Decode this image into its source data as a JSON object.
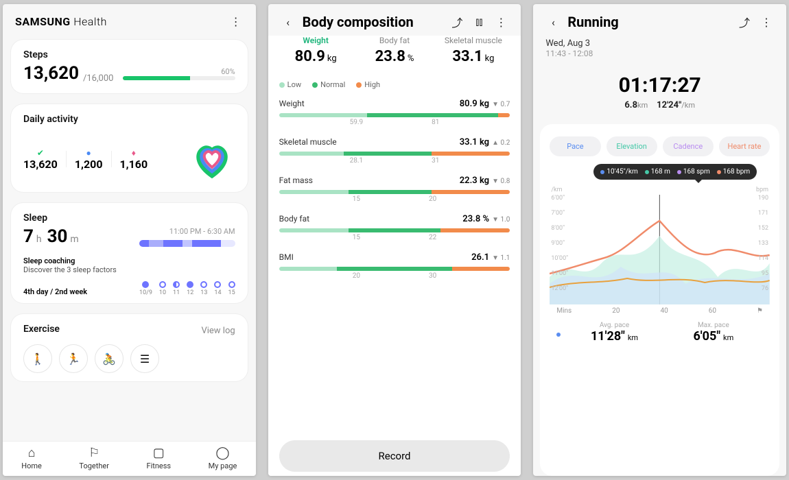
{
  "home": {
    "brand_left": "SAMSUNG",
    "brand_right": "Health",
    "steps": {
      "title": "Steps",
      "count": "13,620",
      "target_prefix": "/",
      "target": "16,000",
      "percent": "60%",
      "bar_pct": 60
    },
    "daily": {
      "title": "Daily activity",
      "val1": "13,620",
      "val2": "1,200",
      "val3": "1,160"
    },
    "sleep": {
      "title": "Sleep",
      "h": "7",
      "h_unit": "h",
      "m": "30",
      "m_unit": "m",
      "range": "11:00 PM - 6:30 AM",
      "coach_title": "Sleep coaching",
      "coach_sub": "Discover the 3 sleep factors",
      "coach_prog": "4th day / 2nd week",
      "days": [
        {
          "lbl": "10/9",
          "state": "f"
        },
        {
          "lbl": "10",
          "state": "o"
        },
        {
          "lbl": "11",
          "state": "half"
        },
        {
          "lbl": "12",
          "state": "f"
        },
        {
          "lbl": "13",
          "state": "o"
        },
        {
          "lbl": "14",
          "state": "o"
        },
        {
          "lbl": "15",
          "state": "o"
        }
      ]
    },
    "exercise": {
      "title": "Exercise",
      "view_log": "View log"
    },
    "nav": {
      "home": "Home",
      "together": "Together",
      "fitness": "Fitness",
      "mypage": "My page"
    }
  },
  "body": {
    "title": "Body composition",
    "summary": {
      "weight_lbl": "Weight",
      "weight_val": "80.9",
      "weight_unit": "kg",
      "fat_lbl": "Body fat",
      "fat_val": "23.8",
      "fat_unit": "%",
      "muscle_lbl": "Skeletal muscle",
      "muscle_val": "33.1",
      "muscle_unit": "kg"
    },
    "legend": {
      "low": "Low",
      "normal": "Normal",
      "high": "High"
    },
    "metrics": [
      {
        "name": "Weight",
        "val": "80.9 kg",
        "delta": "▼ 0.7",
        "t1": "59.9",
        "t2": "81",
        "low": 38,
        "norm": 57,
        "high": 5
      },
      {
        "name": "Skeletal muscle",
        "val": "33.1 kg",
        "delta": "▲ 0.2",
        "t1": "28.1",
        "t2": "31",
        "low": 28,
        "norm": 38,
        "high": 34
      },
      {
        "name": "Fat mass",
        "val": "22.3 kg",
        "delta": "▼ 0.8",
        "t1": "15",
        "t2": "20",
        "low": 30,
        "norm": 36,
        "high": 34
      },
      {
        "name": "Body fat",
        "val": "23.8 %",
        "delta": "▼ 1.0",
        "t1": "15",
        "t2": "22",
        "low": 30,
        "norm": 40,
        "high": 30
      },
      {
        "name": "BMI",
        "val": "26.1",
        "delta": "▼ 1.1",
        "t1": "20",
        "t2": "30",
        "low": 25,
        "norm": 50,
        "high": 25
      }
    ],
    "record": "Record"
  },
  "run": {
    "title": "Running",
    "date": "Wed, Aug 3",
    "time": "11:43 - 12:08",
    "duration": "01:17:27",
    "distance": "6.8",
    "dist_unit": "km",
    "pace": "12'24\"",
    "pace_unit": "/km",
    "tabs": {
      "pace": "Pace",
      "elev": "Elevation",
      "cad": "Cadence",
      "hr": "Heart rate"
    },
    "tooltip": {
      "pace": "10'45\"/km",
      "elev": "168 m",
      "cad": "168 spm",
      "hr": "168 bpm"
    },
    "y_left_unit": "/km",
    "y_right_unit": "bpm",
    "y_left": [
      "6'00\"",
      "7'00\"",
      "8'00\"",
      "9'00\"",
      "10'00\"",
      "11'00\"",
      "12'00\""
    ],
    "y_right": [
      "190",
      "171",
      "152",
      "133",
      "114",
      "95",
      "76"
    ],
    "x_label": "Mins",
    "x": [
      "20",
      "40",
      "60"
    ],
    "avg_lbl": "Avg. pace",
    "avg": "11'28\"",
    "avg_unit": "km",
    "max_lbl": "Max. pace",
    "max": "6'05\"",
    "max_unit": "km"
  },
  "colors": {
    "pace": "#5a8df0",
    "elev": "#45c8a7",
    "cad": "#b98df0",
    "hr": "#f08b6a"
  },
  "chart_data": {
    "type": "line",
    "x": [
      0,
      10,
      20,
      30,
      40,
      50,
      60,
      70,
      80
    ],
    "series": [
      {
        "name": "Pace (min/km)",
        "color": "#5a8df0",
        "values": [
          11.0,
          9.5,
          10.5,
          9.0,
          10.0,
          10.8,
          9.5,
          10.5,
          11.0
        ]
      },
      {
        "name": "Elevation (m)",
        "color": "#45c8a7",
        "values": [
          120,
          145,
          135,
          160,
          168,
          140,
          155,
          130,
          150
        ]
      },
      {
        "name": "Cadence (spm)",
        "color": "#b98df0",
        "values": [
          150,
          158,
          162,
          165,
          168,
          160,
          164,
          155,
          162
        ]
      },
      {
        "name": "Heart rate (bpm)",
        "color": "#f08b6a",
        "values": [
          110,
          118,
          130,
          148,
          168,
          150,
          140,
          158,
          140
        ]
      }
    ],
    "xlabel": "Mins",
    "y_left_label": "/km",
    "y_right_label": "bpm",
    "y_left_range": [
      6,
      12
    ],
    "y_right_range": [
      76,
      190
    ]
  }
}
